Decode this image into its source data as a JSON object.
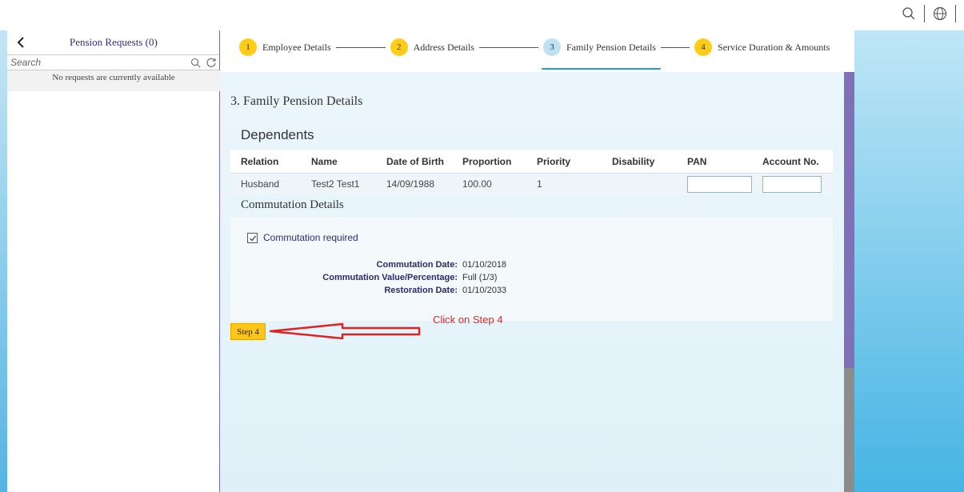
{
  "shell": {
    "search_icon": "search-icon",
    "globe_icon": "globe-icon"
  },
  "master": {
    "title": "Pension Requests (0)",
    "search_placeholder": "Search",
    "no_data": "No requests are currently available"
  },
  "wizard": {
    "steps": [
      {
        "num": "1",
        "label": "Employee Details",
        "state": "done"
      },
      {
        "num": "2",
        "label": "Address Details",
        "state": "done"
      },
      {
        "num": "3",
        "label": "Family Pension Details",
        "state": "active"
      },
      {
        "num": "4",
        "label": "Service Duration & Amounts",
        "state": "done"
      }
    ]
  },
  "section": {
    "title": "3. Family Pension Details",
    "dependents_title": "Dependents",
    "columns": [
      "Relation",
      "Name",
      "Date of Birth",
      "Proportion",
      "Priority",
      "Disability",
      "PAN",
      "Account No."
    ],
    "rows": [
      {
        "relation": "Husband",
        "name": "Test2 Test1",
        "dob": "14/09/1988",
        "proportion": "100.00",
        "priority": "1",
        "disability": "",
        "pan": "",
        "account": ""
      }
    ]
  },
  "commutation": {
    "title": "Commutation Details",
    "checkbox_label": "Commutation required",
    "checked": true,
    "date_label": "Commutation Date:",
    "date_value": "01/10/2018",
    "value_label": "Commutation Value/Percentage:",
    "value_value": "Full (1/3)",
    "restoration_label": "Restoration Date:",
    "restoration_value": "01/10/2033"
  },
  "footer": {
    "step4_label": "Step 4"
  },
  "annotation": {
    "text": "Click on Step 4",
    "color": "#e22222"
  },
  "colors": {
    "accent_yellow": "#ffcc1a",
    "active_blue": "#2d9ad2",
    "scroll_purple": "#7f70b8"
  }
}
